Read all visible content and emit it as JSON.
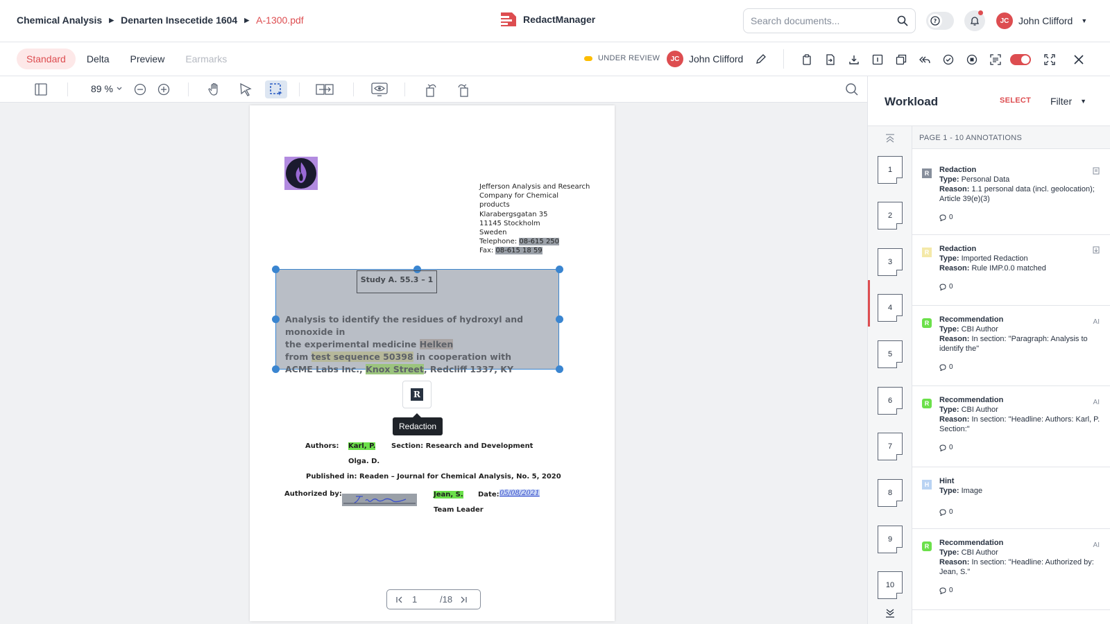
{
  "breadcrumb": {
    "item1": "Chemical Analysis",
    "item2": "Denarten Insecetide 1604",
    "file": "A-1300.pdf"
  },
  "app": {
    "name": "RedactManager"
  },
  "search": {
    "placeholder": "Search documents..."
  },
  "user": {
    "initials": "JC",
    "name": "John Clifford"
  },
  "tabs": [
    "Standard",
    "Delta",
    "Preview",
    "Earmarks"
  ],
  "status": {
    "label": "UNDER REVIEW",
    "color": "#fdbd00"
  },
  "assignee": {
    "initials": "JC",
    "name": "John Clifford"
  },
  "viewer": {
    "zoom": "89 %"
  },
  "document": {
    "address": [
      "Jefferson Analysis and Research",
      "Company for Chemical",
      "products",
      "Klarabergsgatan 35",
      "11145 Stockholm",
      "Sweden"
    ],
    "telephone_label": "Telephone: ",
    "telephone": "08-615 250",
    "fax_label": "Fax: ",
    "fax": "08-615 18 59",
    "study": "Study A. 55.3 – 1",
    "line1": "Analysis to identify the residues of hydroxyl and monoxide in",
    "line2a": "the experimental medicine ",
    "line2b": "Helken",
    "line3a": "from ",
    "line3b": "test sequence 50398",
    "line3c": " in cooperation with",
    "line4a": "ACME Labs Inc., ",
    "line4b": "Knox Street",
    "line4c": ", Redcliff 1337, KY",
    "badge": "R",
    "tooltip": "Redaction",
    "authors_label": "Authors:",
    "author1": "Karl, P.",
    "section": "Section: Research and Development",
    "author2": "Olga. D.",
    "published": "Published in: Readen – Journal for Chemical Analysis, No. 5, 2020",
    "authorized_label": "Authorized by:",
    "authorizer": "Jean, S.",
    "date_label": "Date:",
    "date": "05/08/2021",
    "role": "Team Leader"
  },
  "pager": {
    "current": "1",
    "total": "/18"
  },
  "workload": {
    "title": "Workload",
    "select": "SELECT",
    "filter": "Filter",
    "header": "PAGE 1 - 10 ANNOTATIONS",
    "pages": [
      "1",
      "2",
      "3",
      "4",
      "5",
      "6",
      "7",
      "8",
      "9",
      "10"
    ],
    "annotations": [
      {
        "title": "Redaction",
        "type_label": "Type:",
        "type": " Personal Data",
        "reason_label": "Reason:",
        "reason": " 1.1 personal data (incl. geolocation); Article 39(e)(3)",
        "comments": "0",
        "icon": "R",
        "icon_color": "#868e9b"
      },
      {
        "title": "Redaction",
        "type_label": "Type:",
        "type": " Imported Redaction",
        "reason_label": "Reason:",
        "reason": " Rule IMP.0.0 matched",
        "comments": "0",
        "icon": "R",
        "icon_color": "#f4e9a8"
      },
      {
        "title": "Recommendation",
        "type_label": "Type:",
        "type": " CBI Author",
        "reason_label": "Reason:",
        "reason": " In section: \"Paragraph: Analysis to identify the\"",
        "comments": "0",
        "icon": "R",
        "icon_color": "#6be04a",
        "ai": "AI"
      },
      {
        "title": "Recommendation",
        "type_label": "Type:",
        "type": " CBI Author",
        "reason_label": "Reason:",
        "reason": " In section: \"Headline: Authors: Karl, P. Section:\"",
        "comments": "0",
        "icon": "R",
        "icon_color": "#6be04a",
        "ai": "AI"
      },
      {
        "title": "Hint",
        "type_label": "Type:",
        "type": " Image",
        "comments": "0",
        "icon": "H",
        "icon_color": "#b9d3f3"
      },
      {
        "title": "Recommendation",
        "type_label": "Type:",
        "type": " CBI Author",
        "reason_label": "Reason:",
        "reason": " In section: \"Headline: Authorized by: Jean, S.\"",
        "comments": "0",
        "icon": "R",
        "icon_color": "#6be04a",
        "ai": "AI"
      }
    ]
  }
}
